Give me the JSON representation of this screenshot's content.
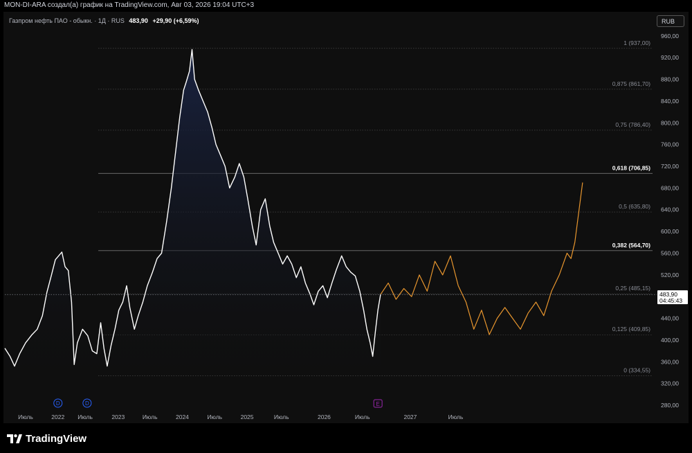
{
  "header": {
    "attribution": "MON-DI-ARA создал(а) график на TradingView.com, Авг 03, 2026 19:04 UTC+3"
  },
  "legend": {
    "symbol": "Газпром нефть ПАО - обыкн. · 1Д · RUS",
    "price": "483,90",
    "change": "+29,90 (+6,59%)"
  },
  "currency_button": "RUB",
  "branding": {
    "logo_text": "TradingView"
  },
  "colors": {
    "background": "#0f0f0f",
    "price_line": "#ffffff",
    "area_top": "#1a2444",
    "projection": "#e8962e",
    "fib_line": "#808080",
    "event_dividend": "#2962ff",
    "event_earnings": "#9c27b0"
  },
  "chart_data": {
    "type": "line",
    "ylim": [
      275,
      975
    ],
    "x_range": [
      0,
      100
    ],
    "y_ticks": [
      {
        "value": 960,
        "label": "960,00"
      },
      {
        "value": 920,
        "label": "920,00"
      },
      {
        "value": 880,
        "label": "880,00"
      },
      {
        "value": 840,
        "label": "840,00"
      },
      {
        "value": 800,
        "label": "800,00"
      },
      {
        "value": 760,
        "label": "760,00"
      },
      {
        "value": 720,
        "label": "720,00"
      },
      {
        "value": 680,
        "label": "680,00"
      },
      {
        "value": 640,
        "label": "640,00"
      },
      {
        "value": 600,
        "label": "600,00"
      },
      {
        "value": 560,
        "label": "560,00"
      },
      {
        "value": 520,
        "label": "520,00"
      },
      {
        "value": 480,
        "label": "480,00"
      },
      {
        "value": 440,
        "label": "440,00"
      },
      {
        "value": 400,
        "label": "400,00"
      },
      {
        "value": 360,
        "label": "360,00"
      },
      {
        "value": 320,
        "label": "320,00"
      },
      {
        "value": 280,
        "label": "280,00"
      }
    ],
    "x_ticks": [
      {
        "x": 3.2,
        "label": "Июль"
      },
      {
        "x": 8.2,
        "label": "2022"
      },
      {
        "x": 12.4,
        "label": "Июль"
      },
      {
        "x": 17.5,
        "label": "2023"
      },
      {
        "x": 22.4,
        "label": "Июль"
      },
      {
        "x": 27.4,
        "label": "2024"
      },
      {
        "x": 32.4,
        "label": "Июль"
      },
      {
        "x": 37.4,
        "label": "2025"
      },
      {
        "x": 42.7,
        "label": "Июль"
      },
      {
        "x": 49.3,
        "label": "2026"
      },
      {
        "x": 55.2,
        "label": "Июль"
      },
      {
        "x": 62.6,
        "label": "2027"
      },
      {
        "x": 69.6,
        "label": "Июль"
      }
    ],
    "fib_levels": [
      {
        "ratio": "1",
        "value": 937.0,
        "label": "1 (937,00)",
        "bold": false
      },
      {
        "ratio": "0,875",
        "value": 861.7,
        "label": "0,875 (861,70)",
        "bold": false
      },
      {
        "ratio": "0,75",
        "value": 786.4,
        "label": "0,75 (786,40)",
        "bold": false
      },
      {
        "ratio": "0,618",
        "value": 706.85,
        "label": "0,618 (706,85)",
        "bold": true
      },
      {
        "ratio": "0,5",
        "value": 635.8,
        "label": "0,5 (635,80)",
        "bold": false
      },
      {
        "ratio": "0,382",
        "value": 564.7,
        "label": "0,382 (564,70)",
        "bold": true
      },
      {
        "ratio": "0,25",
        "value": 485.15,
        "label": "0,25 (485,15)",
        "bold": false
      },
      {
        "ratio": "0,125",
        "value": 409.85,
        "label": "0,125 (409,85)",
        "bold": false
      },
      {
        "ratio": "0",
        "value": 334.55,
        "label": "0 (334,55)",
        "bold": false
      }
    ],
    "current_price": {
      "value": 483.9,
      "label": "483,90",
      "countdown": "04:45:43"
    },
    "series": [
      {
        "values": [
          [
            0,
            385
          ],
          [
            0.8,
            370
          ],
          [
            1.5,
            352
          ],
          [
            2.3,
            375
          ],
          [
            3.2,
            395
          ],
          [
            4.2,
            410
          ],
          [
            5.0,
            420
          ],
          [
            5.8,
            445
          ],
          [
            6.5,
            488
          ],
          [
            7.2,
            520
          ],
          [
            7.8,
            548
          ],
          [
            8.3,
            555
          ],
          [
            8.8,
            562
          ],
          [
            9.3,
            535
          ],
          [
            9.8,
            528
          ],
          [
            10.3,
            470
          ],
          [
            10.7,
            355
          ],
          [
            11.2,
            395
          ],
          [
            12.0,
            420
          ],
          [
            12.8,
            408
          ],
          [
            13.5,
            380
          ],
          [
            14.2,
            375
          ],
          [
            14.8,
            432
          ],
          [
            15.3,
            385
          ],
          [
            15.8,
            352
          ],
          [
            16.4,
            390
          ],
          [
            17.0,
            420
          ],
          [
            17.6,
            455
          ],
          [
            18.2,
            470
          ],
          [
            18.8,
            500
          ],
          [
            19.3,
            460
          ],
          [
            20.0,
            420
          ],
          [
            20.6,
            445
          ],
          [
            21.3,
            470
          ],
          [
            22.0,
            500
          ],
          [
            22.8,
            525
          ],
          [
            23.5,
            550
          ],
          [
            24.2,
            560
          ],
          [
            25.0,
            620
          ],
          [
            25.7,
            680
          ],
          [
            26.4,
            750
          ],
          [
            27.0,
            810
          ],
          [
            27.6,
            860
          ],
          [
            28.0,
            875
          ],
          [
            28.5,
            895
          ],
          [
            28.9,
            935
          ],
          [
            29.3,
            880
          ],
          [
            29.9,
            860
          ],
          [
            30.6,
            840
          ],
          [
            31.3,
            820
          ],
          [
            32.0,
            790
          ],
          [
            32.6,
            760
          ],
          [
            33.3,
            740
          ],
          [
            34.0,
            720
          ],
          [
            34.7,
            680
          ],
          [
            35.5,
            700
          ],
          [
            36.2,
            725
          ],
          [
            36.9,
            700
          ],
          [
            37.5,
            660
          ],
          [
            38.2,
            610
          ],
          [
            38.8,
            575
          ],
          [
            39.5,
            640
          ],
          [
            40.2,
            660
          ],
          [
            40.9,
            610
          ],
          [
            41.5,
            580
          ],
          [
            42.2,
            560
          ],
          [
            42.9,
            540
          ],
          [
            43.6,
            555
          ],
          [
            44.3,
            540
          ],
          [
            45.0,
            515
          ],
          [
            45.7,
            535
          ],
          [
            46.4,
            505
          ],
          [
            47.1,
            485
          ],
          [
            47.7,
            465
          ],
          [
            48.4,
            490
          ],
          [
            49.1,
            500
          ],
          [
            49.8,
            478
          ],
          [
            50.5,
            505
          ],
          [
            51.2,
            530
          ],
          [
            52.0,
            555
          ],
          [
            52.7,
            535
          ],
          [
            53.4,
            525
          ],
          [
            54.1,
            518
          ],
          [
            54.8,
            490
          ],
          [
            55.4,
            455
          ],
          [
            55.9,
            420
          ],
          [
            56.4,
            395
          ],
          [
            56.8,
            370
          ],
          [
            57.2,
            415
          ],
          [
            57.6,
            455
          ],
          [
            58.0,
            483.9
          ]
        ]
      },
      {
        "values": [
          [
            58.0,
            483.9
          ],
          [
            59.2,
            505
          ],
          [
            60.4,
            475
          ],
          [
            61.6,
            495
          ],
          [
            62.8,
            480
          ],
          [
            64.0,
            520
          ],
          [
            65.2,
            490
          ],
          [
            66.4,
            545
          ],
          [
            67.6,
            520
          ],
          [
            68.8,
            555
          ],
          [
            70.0,
            500
          ],
          [
            71.2,
            470
          ],
          [
            72.4,
            420
          ],
          [
            73.6,
            455
          ],
          [
            74.8,
            410
          ],
          [
            76.0,
            440
          ],
          [
            77.2,
            460
          ],
          [
            78.4,
            440
          ],
          [
            79.6,
            420
          ],
          [
            80.8,
            450
          ],
          [
            82.0,
            470
          ],
          [
            83.2,
            445
          ],
          [
            84.4,
            490
          ],
          [
            85.6,
            520
          ],
          [
            86.8,
            560
          ],
          [
            87.4,
            550
          ],
          [
            88.0,
            580
          ],
          [
            89.2,
            690
          ]
        ]
      }
    ],
    "events": [
      {
        "x": 8.2,
        "label": "D"
      },
      {
        "x": 12.7,
        "label": "D"
      },
      {
        "x": 57.6,
        "label": "E"
      }
    ]
  }
}
